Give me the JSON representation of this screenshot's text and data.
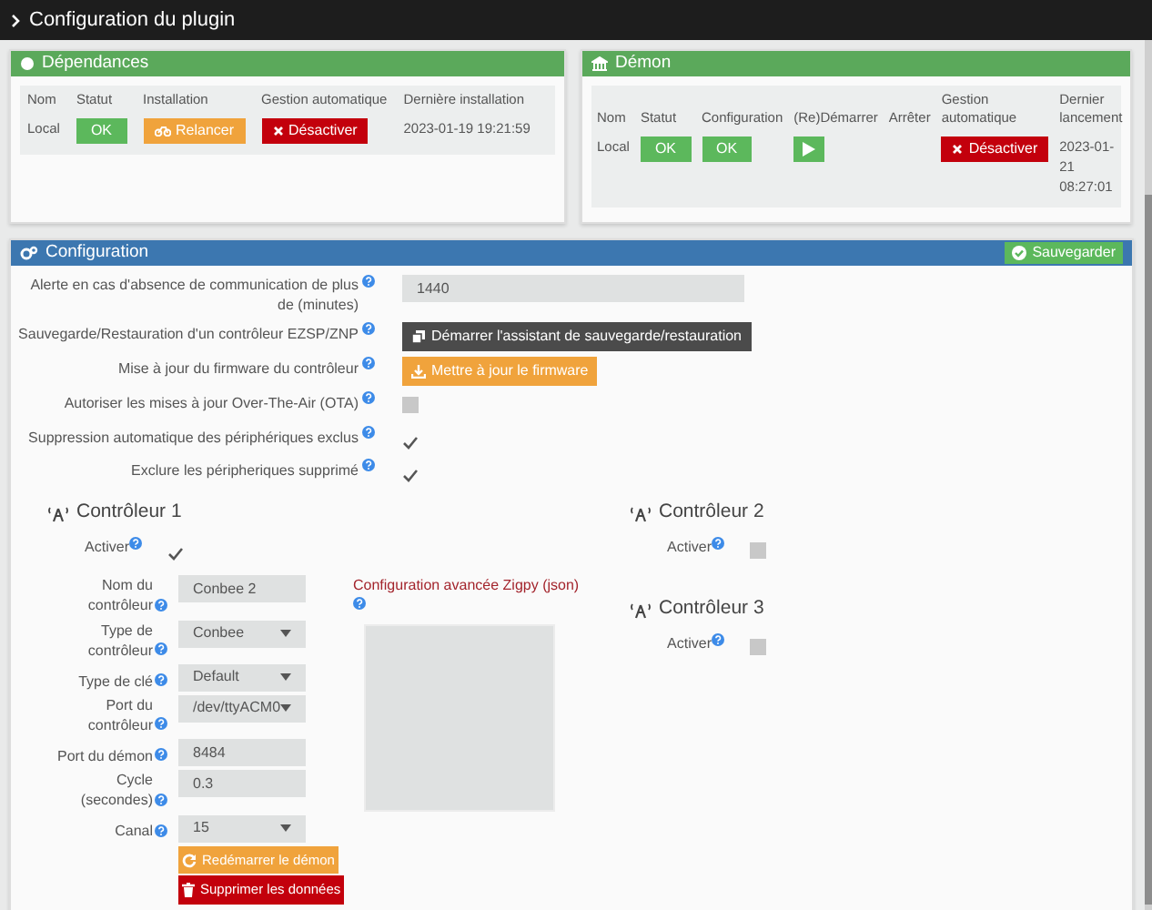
{
  "window": {
    "title": "Configuration du plugin"
  },
  "dependencies": {
    "title": "Dépendances",
    "columns": [
      "Nom",
      "Statut",
      "Installation",
      "Gestion automatique",
      "Dernière installation"
    ],
    "row": {
      "name": "Local",
      "status": "OK",
      "install_button": "Relancer",
      "auto_button": "Désactiver",
      "last_install": "2023-01-19 19:21:59"
    }
  },
  "daemon": {
    "title": "Démon",
    "columns": [
      "Nom",
      "Statut",
      "Configuration",
      "(Re)Démarrer",
      "Arrêter",
      "Gestion automatique",
      "Dernier lancement"
    ],
    "row": {
      "name": "Local",
      "status": "OK",
      "configuration": "OK",
      "auto_button": "Désactiver",
      "last_launch": "2023-01-21 08:27:01"
    }
  },
  "configuration": {
    "title": "Configuration",
    "save_button": "Sauvegarder",
    "settings": [
      {
        "kind": "input",
        "label": "Alerte en cas d'absence de communication de plus de (minutes)",
        "value": "1440"
      },
      {
        "kind": "button",
        "label": "Sauvegarde/Restauration d'un contrôleur EZSP/ZNP",
        "button": "Démarrer l'assistant de sauvegarde/restauration"
      },
      {
        "kind": "button",
        "label": "Mise à jour du firmware du contrôleur",
        "button": "Mettre à jour le firmware"
      },
      {
        "kind": "checkbox",
        "label": "Autoriser les mises à jour Over-The-Air (OTA)",
        "checked": false
      },
      {
        "kind": "checkbox",
        "label": "Suppression automatique des périphériques exclus",
        "checked": true
      },
      {
        "kind": "checkbox",
        "label": "Exclure les péripheriques supprimé",
        "checked": true
      }
    ],
    "controllers": [
      {
        "title": "Contrôleur 1",
        "activate_label": "Activer",
        "checked": true,
        "fields": [
          {
            "kind": "input",
            "label": "Nom du contrôleur",
            "value": "Conbee 2"
          },
          {
            "kind": "select",
            "label": "Type de contrôleur",
            "value": "Conbee"
          },
          {
            "kind": "select",
            "label": "Type de clé",
            "value": "Default"
          },
          {
            "kind": "select",
            "label": "Port du contrôleur",
            "value": "/dev/ttyACM0"
          },
          {
            "kind": "input",
            "label": "Port du démon",
            "value": "8484"
          },
          {
            "kind": "input",
            "label": "Cycle (secondes)",
            "value": "0.3"
          },
          {
            "kind": "select",
            "label": "Canal",
            "value": "15"
          }
        ],
        "buttons": [
          "Redémarrer le démon",
          "Supprimer les données"
        ],
        "advanced_label": "Configuration avancée Zigpy (json)"
      },
      {
        "title": "Contrôleur 2",
        "activate_label": "Activer",
        "checked": false
      },
      {
        "title": "Contrôleur 3",
        "activate_label": "Activer",
        "checked": false
      }
    ]
  }
}
